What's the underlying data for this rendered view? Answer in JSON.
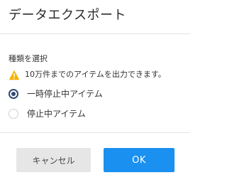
{
  "dialog": {
    "title": "データエクスポート"
  },
  "selection": {
    "label": "種類を選択",
    "warning_icon": "warning-icon",
    "warning_text": "10万件までのアイテムを出力できます。",
    "warning_color": "#f3b400",
    "options": [
      {
        "label": "一時停止中アイテム",
        "selected": true
      },
      {
        "label": "停止中アイテム",
        "selected": false
      }
    ]
  },
  "footer": {
    "cancel_label": "キャンセル",
    "ok_label": "OK"
  },
  "colors": {
    "primary": "#1a90f0",
    "radio_selected": "#2f4a73",
    "cancel_bg": "#e6e6e6"
  }
}
